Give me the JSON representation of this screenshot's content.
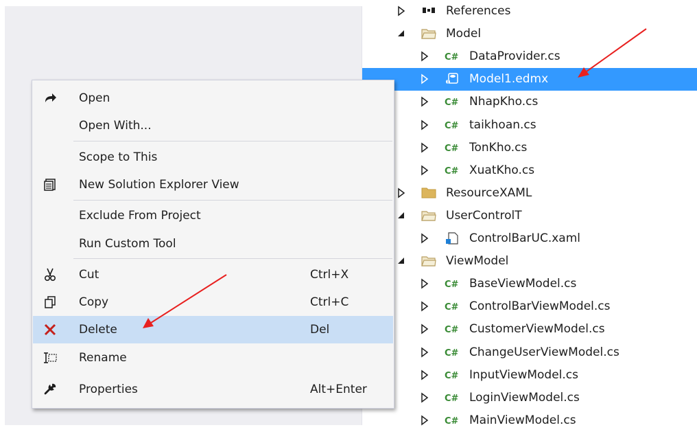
{
  "tree": {
    "items": [
      {
        "label": "References",
        "icon": "references-icon",
        "expander": "collapsed",
        "kind": "references"
      },
      {
        "label": "Model",
        "icon": "folder-open-icon",
        "expander": "expanded",
        "kind": "folder-open"
      },
      {
        "label": "DataProvider.cs",
        "icon": "csharp-file-icon",
        "expander": "collapsed",
        "kind": "cs"
      },
      {
        "label": "Model1.edmx",
        "icon": "edmx-file-icon",
        "expander": "collapsed",
        "kind": "edmx",
        "selected": true
      },
      {
        "label": "NhapKho.cs",
        "icon": "csharp-file-icon",
        "expander": "collapsed",
        "kind": "cs"
      },
      {
        "label": "taikhoan.cs",
        "icon": "csharp-file-icon",
        "expander": "collapsed",
        "kind": "cs"
      },
      {
        "label": "TonKho.cs",
        "icon": "csharp-file-icon",
        "expander": "collapsed",
        "kind": "cs"
      },
      {
        "label": "XuatKho.cs",
        "icon": "csharp-file-icon",
        "expander": "collapsed",
        "kind": "cs"
      },
      {
        "label": "ResourceXAML",
        "icon": "folder-icon",
        "expander": "collapsed",
        "kind": "folder"
      },
      {
        "label": "UserControlT",
        "icon": "folder-open-icon",
        "expander": "expanded",
        "kind": "folder-open"
      },
      {
        "label": "ControlBarUC.xaml",
        "icon": "xaml-file-icon",
        "expander": "collapsed",
        "kind": "xaml"
      },
      {
        "label": "ViewModel",
        "icon": "folder-open-icon",
        "expander": "expanded",
        "kind": "folder-open"
      },
      {
        "label": "BaseViewModel.cs",
        "icon": "csharp-file-icon",
        "expander": "collapsed",
        "kind": "cs"
      },
      {
        "label": "ControlBarViewModel.cs",
        "icon": "csharp-file-icon",
        "expander": "collapsed",
        "kind": "cs"
      },
      {
        "label": "CustomerViewModel.cs",
        "icon": "csharp-file-icon",
        "expander": "collapsed",
        "kind": "cs"
      },
      {
        "label": "ChangeUserViewModel.cs",
        "icon": "csharp-file-icon",
        "expander": "collapsed",
        "kind": "cs"
      },
      {
        "label": "InputViewModel.cs",
        "icon": "csharp-file-icon",
        "expander": "collapsed",
        "kind": "cs"
      },
      {
        "label": "LoginViewModel.cs",
        "icon": "csharp-file-icon",
        "expander": "collapsed",
        "kind": "cs"
      },
      {
        "label": "MainViewModel.cs",
        "icon": "csharp-file-icon",
        "expander": "collapsed",
        "kind": "cs"
      }
    ],
    "csharp_glyph": "C#"
  },
  "context_menu": {
    "open": {
      "label": "Open",
      "icon": "open-arrow-icon"
    },
    "open_with": {
      "label": "Open With..."
    },
    "scope_to_this": {
      "label": "Scope to This"
    },
    "new_solution_explorer_view": {
      "label": "New Solution Explorer View",
      "icon": "new-window-icon"
    },
    "exclude_from_project": {
      "label": "Exclude From Project"
    },
    "run_custom_tool": {
      "label": "Run Custom Tool"
    },
    "cut": {
      "label": "Cut",
      "shortcut": "Ctrl+X",
      "icon": "scissors-icon"
    },
    "copy": {
      "label": "Copy",
      "shortcut": "Ctrl+C",
      "icon": "copy-icon"
    },
    "delete": {
      "label": "Delete",
      "shortcut": "Del",
      "icon": "delete-x-icon",
      "hovered": true
    },
    "rename": {
      "label": "Rename",
      "icon": "rename-icon"
    },
    "properties": {
      "label": "Properties",
      "shortcut": "Alt+Enter",
      "icon": "wrench-icon"
    }
  },
  "colors": {
    "selection": "#3399ff",
    "menu_hover": "#c9def5",
    "annotation_arrow": "#e8201f",
    "csharp_green": "#388a34",
    "delete_red": "#c5201b"
  }
}
